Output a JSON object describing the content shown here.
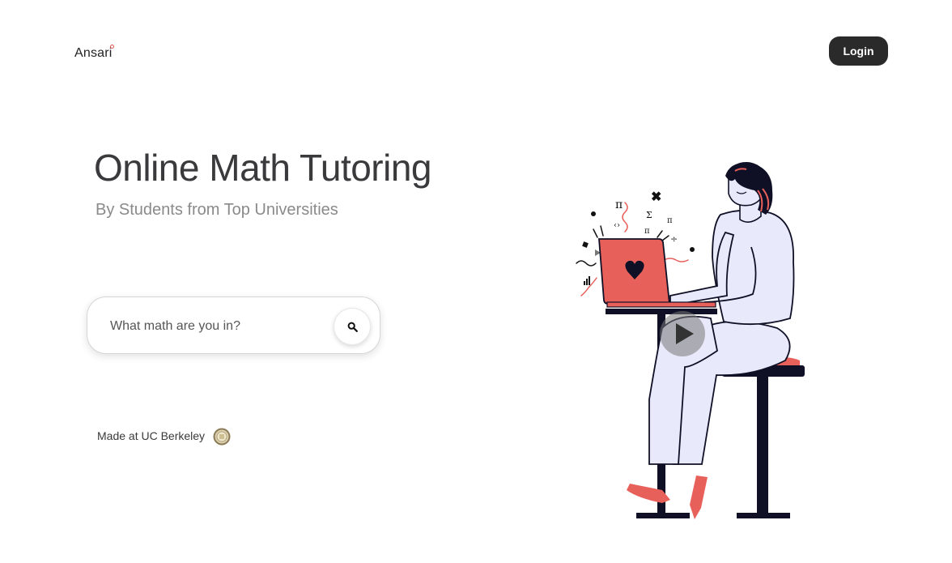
{
  "header": {
    "logo_text": "Ansari",
    "login_label": "Login"
  },
  "hero": {
    "title": "Online Math Tutoring",
    "subtitle": "By Students from Top Universities"
  },
  "search": {
    "placeholder": "What math are you in?",
    "value": ""
  },
  "footer": {
    "made_at": "Made at UC Berkeley"
  },
  "icons": {
    "search": "search-icon",
    "play": "play-icon",
    "seal": "uc-berkeley-seal-icon"
  },
  "colors": {
    "accent": "#e8605a",
    "dark": "#2a2a2a",
    "navy": "#0f1026",
    "lavender": "#e8e9fb"
  }
}
